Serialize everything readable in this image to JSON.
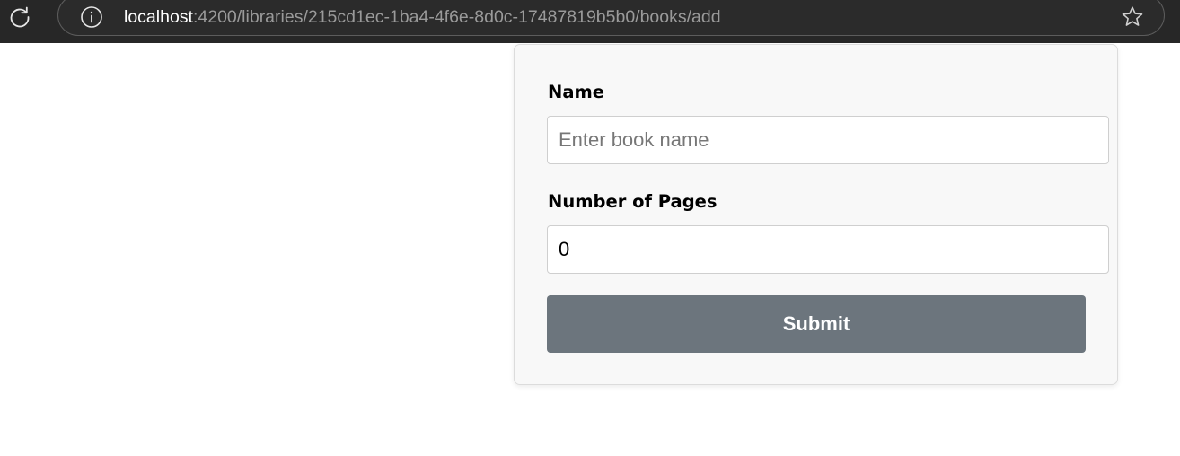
{
  "browser": {
    "url_host": "localhost",
    "url_path": ":4200/libraries/215cd1ec-1ba4-4f6e-8d0c-17487819b5b0/books/add",
    "icons": [
      "reload-icon",
      "site-info-icon",
      "bookmark-star-icon"
    ]
  },
  "form": {
    "name_label": "Name",
    "name_placeholder": "Enter book name",
    "name_value": "",
    "pages_label": "Number of Pages",
    "pages_value": "0",
    "submit_label": "Submit"
  },
  "colors": {
    "browser_bar": "#272727",
    "card_background": "#f8f8f8",
    "submit_button": "#6c757d",
    "submit_text": "#ffffff"
  }
}
